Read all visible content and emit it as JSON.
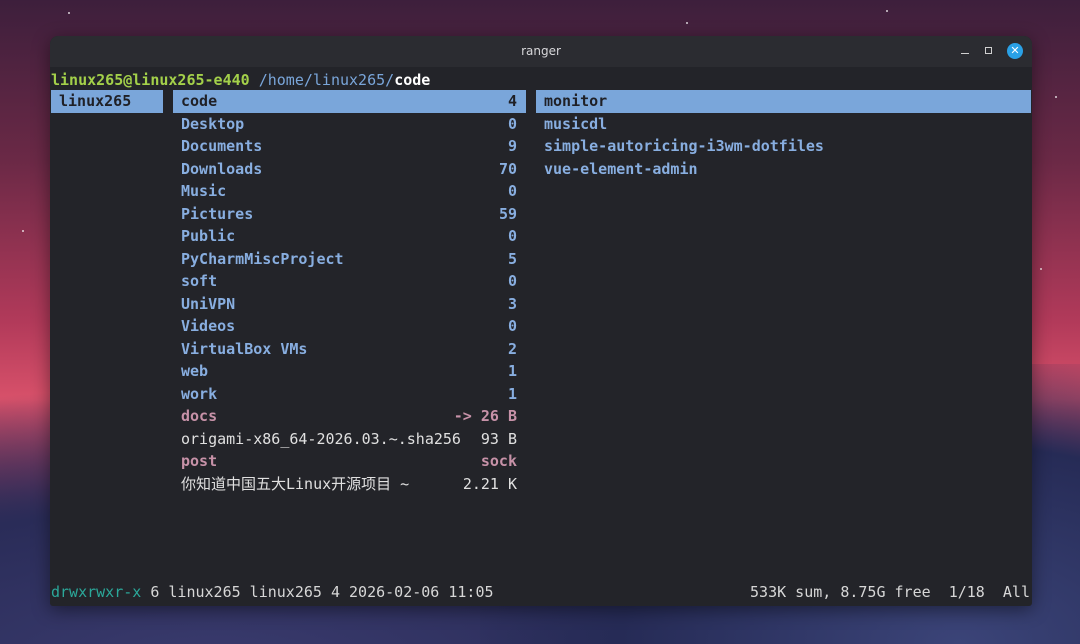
{
  "window": {
    "title": "ranger"
  },
  "prompt": {
    "user_host": "linux265@linux265-e440",
    "path": "/home/linux265/",
    "current": "code"
  },
  "parent_column": [
    {
      "name": "linux265"
    }
  ],
  "current_column": [
    {
      "name": "code",
      "meta": "4",
      "kind": "dir",
      "selected": true
    },
    {
      "name": "Desktop",
      "meta": "0",
      "kind": "dir"
    },
    {
      "name": "Documents",
      "meta": "9",
      "kind": "dir"
    },
    {
      "name": "Downloads",
      "meta": "70",
      "kind": "dir"
    },
    {
      "name": "Music",
      "meta": "0",
      "kind": "dir"
    },
    {
      "name": "Pictures",
      "meta": "59",
      "kind": "dir"
    },
    {
      "name": "Public",
      "meta": "0",
      "kind": "dir"
    },
    {
      "name": "PyCharmMiscProject",
      "meta": "5",
      "kind": "dir"
    },
    {
      "name": "soft",
      "meta": "0",
      "kind": "dir"
    },
    {
      "name": "UniVPN",
      "meta": "3",
      "kind": "dir"
    },
    {
      "name": "Videos",
      "meta": "0",
      "kind": "dir"
    },
    {
      "name": "VirtualBox VMs",
      "meta": "2",
      "kind": "dir"
    },
    {
      "name": "web",
      "meta": "1",
      "kind": "dir"
    },
    {
      "name": "work",
      "meta": "1",
      "kind": "dir"
    },
    {
      "name": "docs",
      "meta": "-> 26 B",
      "kind": "link"
    },
    {
      "name": "origami-x86_64-2026.03.~.sha256",
      "meta": "93 B",
      "kind": "file"
    },
    {
      "name": "post",
      "meta": "sock",
      "kind": "link"
    },
    {
      "name": "你知道中国五大Linux开源项目 ~",
      "meta": "2.21 K",
      "kind": "file"
    }
  ],
  "preview_column": [
    {
      "name": "monitor",
      "selected": true
    },
    {
      "name": "musicdl"
    },
    {
      "name": "simple-autoricing-i3wm-dotfiles"
    },
    {
      "name": "vue-element-admin"
    }
  ],
  "status": {
    "perms": "drwxrwxr-x",
    "info": " 6 linux265 linux265 4 2026-02-06 11:05",
    "right": "533K sum, 8.75G free  1/18  All"
  },
  "colors": {
    "accent": "#7aa6da",
    "user": "#a3d04a",
    "perm": "#2ba89a",
    "link": "#c792a8",
    "close": "#2aa1e6"
  }
}
